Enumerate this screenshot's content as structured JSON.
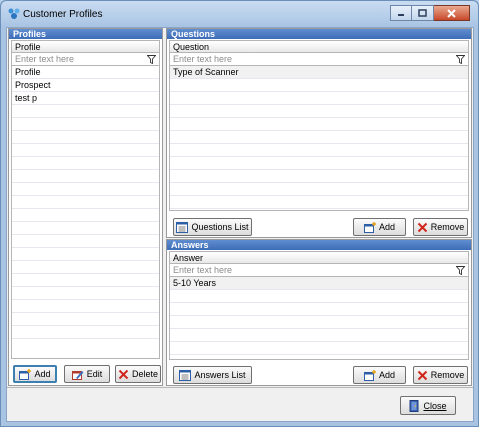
{
  "window": {
    "title": "Customer Profiles"
  },
  "profiles": {
    "header": "Profiles",
    "column": "Profile",
    "filter_placeholder": "Enter text here",
    "rows": [
      "Profile",
      "Prospect",
      "test p"
    ],
    "buttons": {
      "add": "Add",
      "edit": "Edit",
      "delete": "Delete"
    }
  },
  "questions": {
    "header": "Questions",
    "column": "Question",
    "filter_placeholder": "Enter text here",
    "rows": [
      "Type of Scanner"
    ],
    "buttons": {
      "list": "Questions List",
      "add": "Add",
      "remove": "Remove"
    }
  },
  "answers": {
    "header": "Answers",
    "column": "Answer",
    "filter_placeholder": "Enter text here",
    "rows": [
      "5-10 Years"
    ],
    "buttons": {
      "list": "Answers List",
      "add": "Add",
      "remove": "Remove"
    }
  },
  "footer": {
    "close": "Close"
  },
  "icons": {
    "app": "profiles-app-icon",
    "filter": "funnel-icon",
    "add": "add-window-icon",
    "edit": "edit-icon",
    "delete": "red-x-icon",
    "list": "list-window-icon",
    "close": "door-exit-icon"
  },
  "colors": {
    "panel_header": "#4a7cc4",
    "title_bar": "#b9d1ea",
    "close_button": "#c8472a",
    "focus_border": "#3c7fb1"
  }
}
